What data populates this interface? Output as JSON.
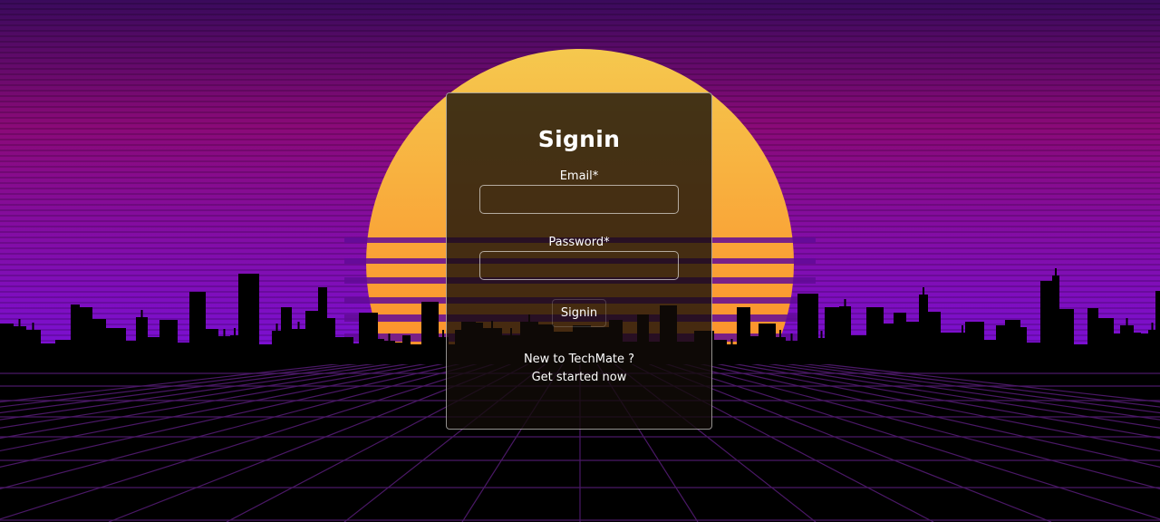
{
  "colors": {
    "sky_top": "#3a0a5c",
    "sky_mid": "#8a0a78",
    "sky_bottom": "#7a10d8",
    "sun_top": "#f5c84e",
    "sun_bottom": "#ff7a1c",
    "grid_line": "#5a1a7a",
    "card_border": "#ffffff"
  },
  "background": {
    "theme": "synthwave sunset with city skyline and neon grid"
  },
  "signin": {
    "title": "Signin",
    "email_label": "Email*",
    "email_value": "",
    "password_label": "Password*",
    "password_value": "",
    "submit_label": "Signin",
    "signup_prompt": "New to TechMate ?",
    "signup_link": "Get started now"
  }
}
